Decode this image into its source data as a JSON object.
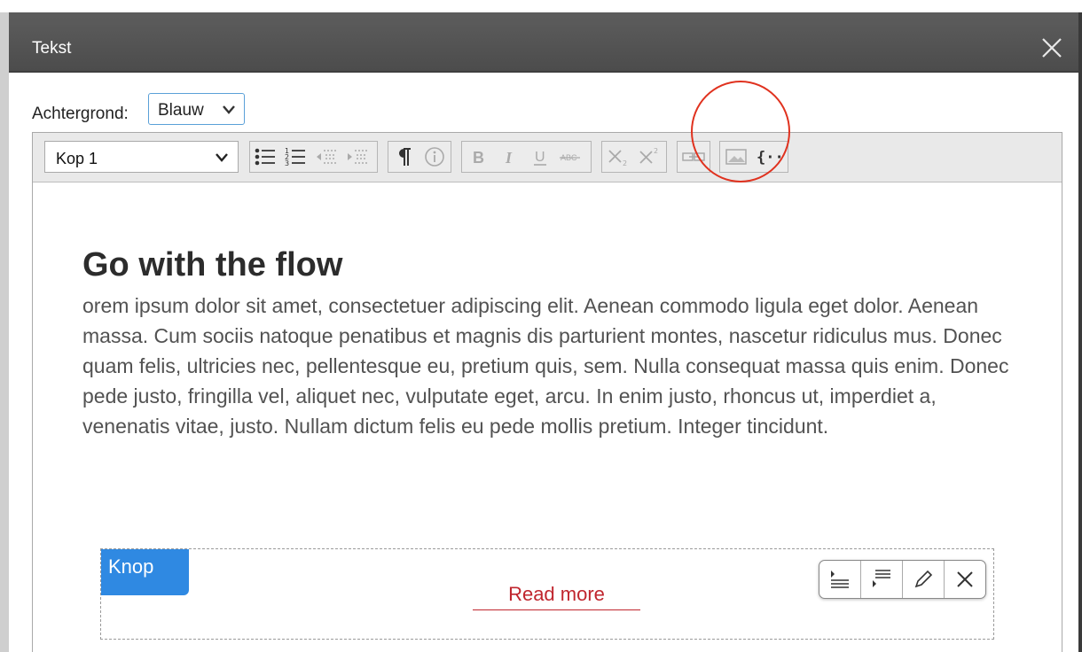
{
  "dialog": {
    "title": "Tekst",
    "close_icon": "close-icon"
  },
  "background_field": {
    "label": "Achtergrond:",
    "selected": "Blauw"
  },
  "toolbar": {
    "format_selected": "Kop 1",
    "buttons": [
      "bulleted-list-icon",
      "numbered-list-icon",
      "outdent-icon",
      "indent-icon",
      "paragraph-icon",
      "info-icon",
      "bold-icon",
      "italic-icon",
      "underline-icon",
      "strikethrough-icon",
      "subscript-icon",
      "superscript-icon",
      "link-icon",
      "image-icon",
      "variable-icon"
    ],
    "highlight_color": "#e0321f"
  },
  "content": {
    "heading": "Go with the flow",
    "paragraph": "orem ipsum dolor sit amet, consectetuer adipiscing elit. Aenean commodo ligula eget dolor. Aenean massa. Cum sociis natoque penatibus et magnis dis parturient montes, nascetur ridiculus mus. Donec quam felis, ultricies nec, pellentesque eu, pretium quis, sem. Nulla consequat massa quis enim. Donec pede justo, fringilla vel, aliquet nec, vulputate eget, arcu. In enim justo, rhoncus ut, imperdiet a, venenatis vitae, justo. Nullam dictum felis eu pede mollis pretium. Integer tincidunt."
  },
  "button_block": {
    "tag": "Knop",
    "link_text": "Read more",
    "tools": [
      "align-left-icon",
      "align-right-icon",
      "pencil-icon",
      "close-icon"
    ]
  },
  "colors": {
    "titlebar": "#4f4f4f",
    "accent_blue": "#2f89e2",
    "link_red": "#c0262e"
  }
}
